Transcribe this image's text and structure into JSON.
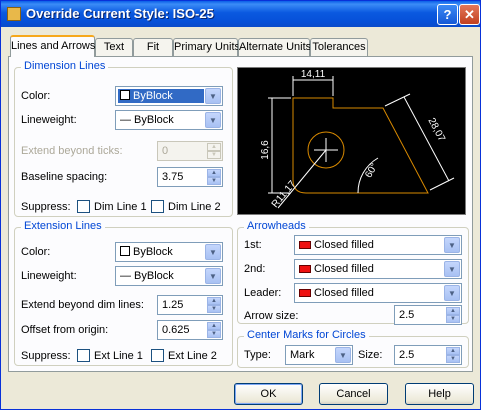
{
  "window": {
    "title": "Override Current Style: ISO-25",
    "help_glyph": "?",
    "close_glyph": "✕"
  },
  "tabs": [
    {
      "label": "Lines and Arrows",
      "active": true
    },
    {
      "label": "Text"
    },
    {
      "label": "Fit"
    },
    {
      "label": "Primary Units"
    },
    {
      "label": "Alternate Units"
    },
    {
      "label": "Tolerances"
    }
  ],
  "dimension_lines": {
    "title": "Dimension Lines",
    "color_label": "Color:",
    "color_value": "ByBlock",
    "lineweight_label": "Lineweight:",
    "lineweight_value": "— ByBlock",
    "extend_label": "Extend beyond ticks:",
    "extend_value": "0",
    "baseline_label": "Baseline spacing:",
    "baseline_value": "3.75",
    "suppress_label": "Suppress:",
    "dim_line1_label": "Dim Line 1",
    "dim_line2_label": "Dim Line 2"
  },
  "extension_lines": {
    "title": "Extension Lines",
    "color_label": "Color:",
    "color_value": "ByBlock",
    "lineweight_label": "Lineweight:",
    "lineweight_value": "— ByBlock",
    "extend_label": "Extend beyond dim lines:",
    "extend_value": "1.25",
    "offset_label": "Offset from origin:",
    "offset_value": "0.625",
    "suppress_label": "Suppress:",
    "ext_line1_label": "Ext Line 1",
    "ext_line2_label": "Ext Line 2"
  },
  "preview": {
    "dim_top": "14,11",
    "dim_left": "16,6",
    "dim_right": "28,07",
    "dim_angle": "60°",
    "dim_radius": "R11,17"
  },
  "arrowheads": {
    "title": "Arrowheads",
    "first_label": "1st:",
    "first_value": "Closed filled",
    "second_label": "2nd:",
    "second_value": "Closed filled",
    "leader_label": "Leader:",
    "leader_value": "Closed filled",
    "size_label": "Arrow size:",
    "size_value": "2.5"
  },
  "center_marks": {
    "title": "Center Marks for Circles",
    "type_label": "Type:",
    "type_value": "Mark",
    "size_label": "Size:",
    "size_value": "2.5"
  },
  "buttons": {
    "ok": "OK",
    "cancel": "Cancel",
    "help": "Help"
  },
  "colors": {
    "title_bar": "#0a59e0",
    "group_title": "#0046d5",
    "preview_bg": "#000000",
    "preview_geometry": "#d98a00",
    "preview_dims": "#ffffff"
  }
}
